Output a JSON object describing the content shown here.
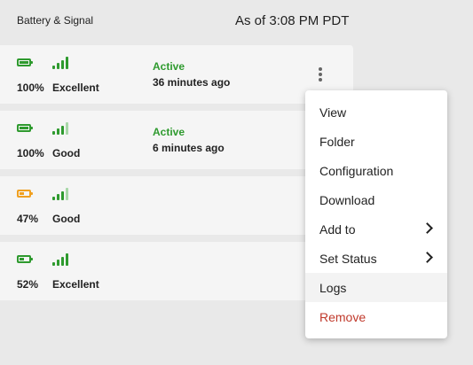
{
  "header": {
    "title": "Battery & Signal",
    "timestamp": "As of 3:08 PM PDT"
  },
  "colors": {
    "good": "#2e9a2e",
    "warn": "#f0a020",
    "danger": "#c0392b",
    "signal_dim": "#a8d8a8"
  },
  "devices": [
    {
      "battery_percent": "100%",
      "battery_level": 1.0,
      "battery_color": "#2e9a2e",
      "battery_icon": "battery-full-icon",
      "signal_bars": 4,
      "signal_quality": "Excellent",
      "status": "Active",
      "last_seen": "36 minutes ago"
    },
    {
      "battery_percent": "100%",
      "battery_level": 1.0,
      "battery_color": "#2e9a2e",
      "battery_icon": "battery-full-icon",
      "signal_bars": 3,
      "signal_quality": "Good",
      "status": "Active",
      "last_seen": "6 minutes ago"
    },
    {
      "battery_percent": "47%",
      "battery_level": 0.47,
      "battery_color": "#f0a020",
      "battery_icon": "battery-half-icon",
      "signal_bars": 3,
      "signal_quality": "Good"
    },
    {
      "battery_percent": "52%",
      "battery_level": 0.52,
      "battery_color": "#2e9a2e",
      "battery_icon": "battery-half-icon",
      "signal_bars": 4,
      "signal_quality": "Excellent"
    }
  ],
  "menu": {
    "items": [
      {
        "label": "View"
      },
      {
        "label": "Folder"
      },
      {
        "label": "Configuration"
      },
      {
        "label": "Download"
      },
      {
        "label": "Add to",
        "submenu_icon": "chevron-right-icon"
      },
      {
        "label": "Set Status",
        "submenu_icon": "chevron-right-icon"
      },
      {
        "label": "Logs",
        "highlighted": true
      },
      {
        "label": "Remove",
        "danger": true
      }
    ]
  }
}
